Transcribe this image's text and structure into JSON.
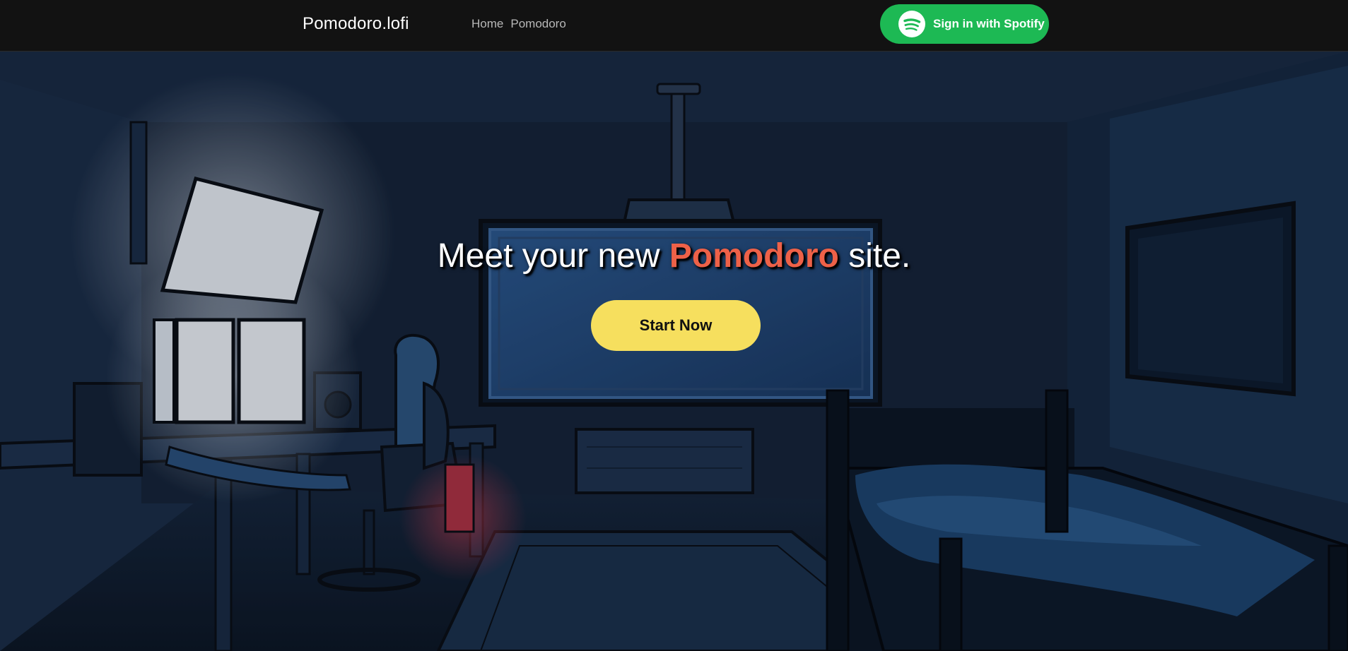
{
  "nav": {
    "brand": "Pomodoro.lofi",
    "links": [
      {
        "label": "Home"
      },
      {
        "label": "Pomodoro"
      }
    ],
    "spotify_button": {
      "label": "Sign in with Spotify",
      "icon": "spotify-icon",
      "color": "#1db954"
    }
  },
  "hero": {
    "headline_before": "Meet your new",
    "headline_accent": "Pomodoro",
    "headline_after": "site.",
    "accent_color": "#ee6148",
    "cta_label": "Start Now",
    "cta_color": "#f6df5e",
    "background": "lofi-night-bedroom-illustration"
  }
}
